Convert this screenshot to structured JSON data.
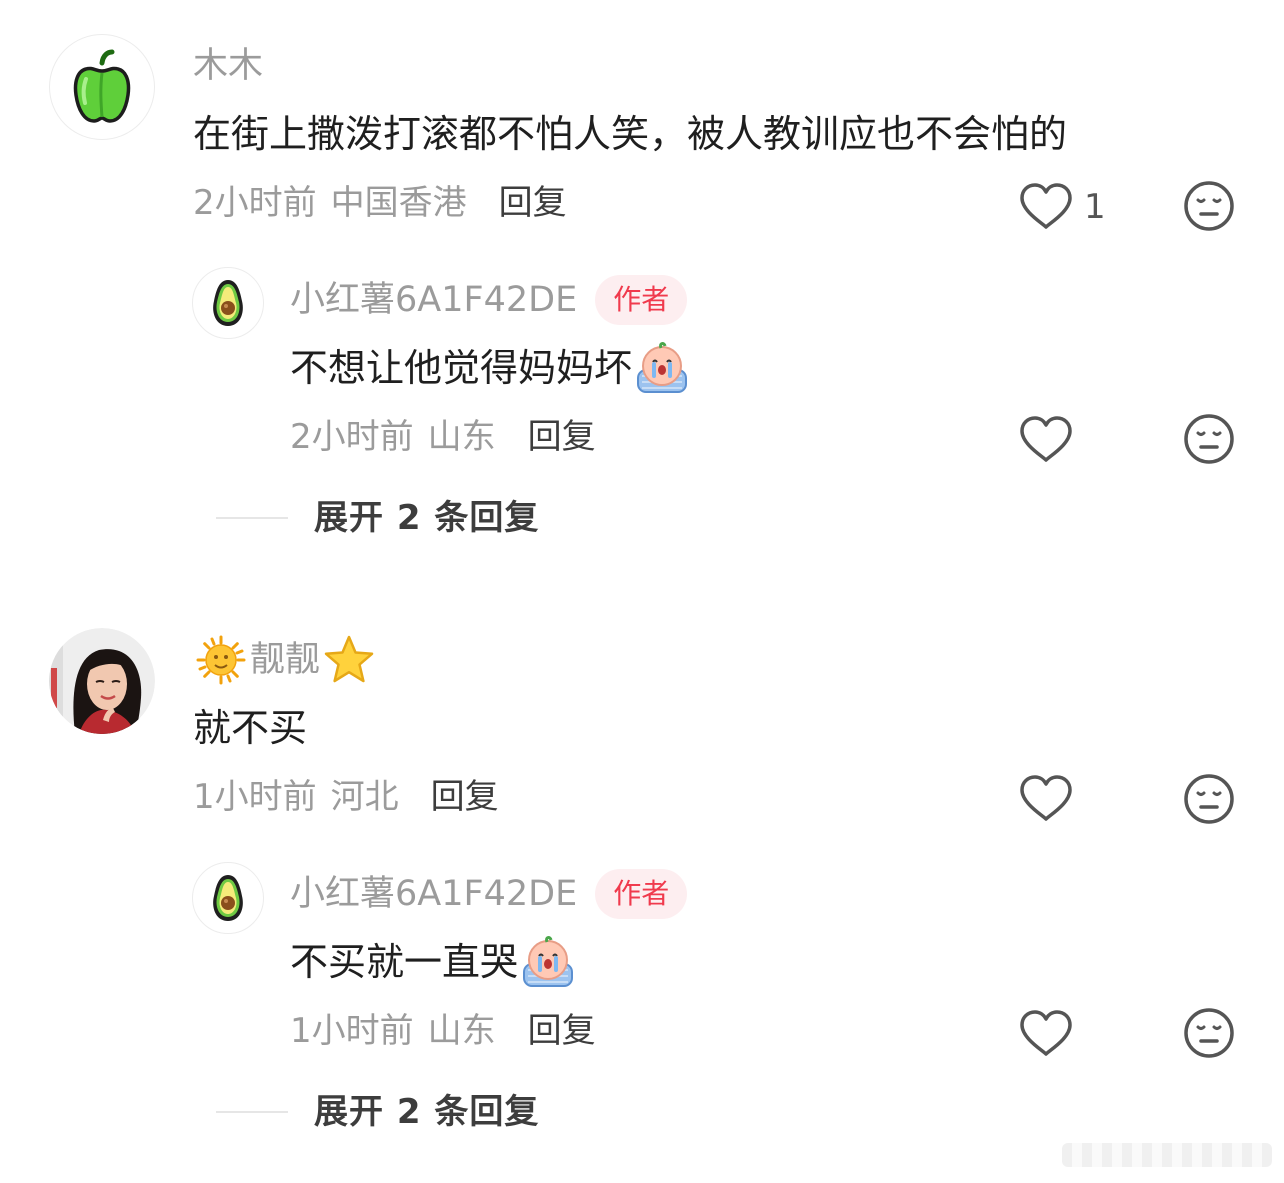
{
  "comments": [
    {
      "username": "木木",
      "content": "在街上撒泼打滚都不怕人笑，被人教训应也不会怕的",
      "time": "2小时前",
      "location": "中国香港",
      "reply_label": "回复",
      "likes": "1",
      "avatar_icon": "green-pepper-icon",
      "replies": [
        {
          "username": "小红薯6A1F42DE",
          "badge": "作者",
          "content": "不想让他觉得妈妈坏",
          "emoji": "crying-emoji-icon",
          "time": "2小时前",
          "location": "山东",
          "reply_label": "回复",
          "avatar_icon": "avocado-icon"
        }
      ],
      "expand_label": "展开 2 条回复"
    },
    {
      "username": "靓靓",
      "username_prefix_icon": "sun-face-icon",
      "username_suffix_icon": "star-icon",
      "content": "就不买",
      "time": "1小时前",
      "location": "河北",
      "reply_label": "回复",
      "likes": "",
      "avatar_icon": "woman-photo-avatar",
      "replies": [
        {
          "username": "小红薯6A1F42DE",
          "badge": "作者",
          "content": "不买就一直哭",
          "emoji": "crying-emoji-icon",
          "time": "1小时前",
          "location": "山东",
          "reply_label": "回复",
          "avatar_icon": "avocado-icon"
        }
      ],
      "expand_label": "展开 2 条回复"
    }
  ],
  "colors": {
    "author_badge_bg": "#fdeef0",
    "author_badge_text": "#f03a4d",
    "meta_gray": "#9b9b9b",
    "icon_gray": "#555555"
  }
}
